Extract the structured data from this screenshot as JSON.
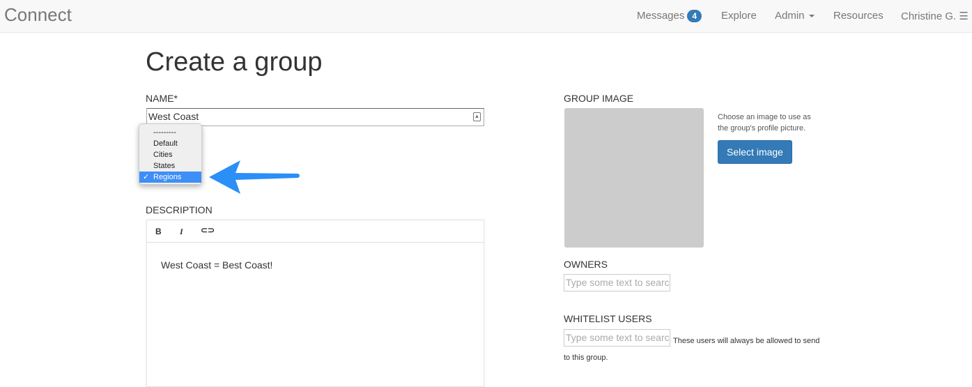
{
  "nav": {
    "brand": "Connect",
    "messages": "Messages",
    "messages_count": "4",
    "explore": "Explore",
    "admin": "Admin",
    "resources": "Resources",
    "user": "Christine G."
  },
  "page_title": "Create a group",
  "name": {
    "label": "NAME*",
    "value": "West Coast"
  },
  "category_dropdown": {
    "options": [
      "---------",
      "Default",
      "Cities",
      "States",
      "Regions"
    ],
    "selected": "Regions",
    "check": "✓"
  },
  "description": {
    "label": "DESCRIPTION",
    "bold": "B",
    "italic": "I",
    "content": "West Coast = Best Coast!"
  },
  "group_image": {
    "label": "GROUP IMAGE",
    "help": "Choose an image to use as the group's profile picture.",
    "button": "Select image"
  },
  "owners": {
    "label": "OWNERS",
    "placeholder": "Type some text to search"
  },
  "whitelist": {
    "label": "WHITELIST USERS",
    "placeholder": "Type some text to search",
    "help": "These users will always be allowed to send to this group."
  },
  "colors": {
    "accent": "#337ab7",
    "arrow": "#2a8ff7"
  }
}
